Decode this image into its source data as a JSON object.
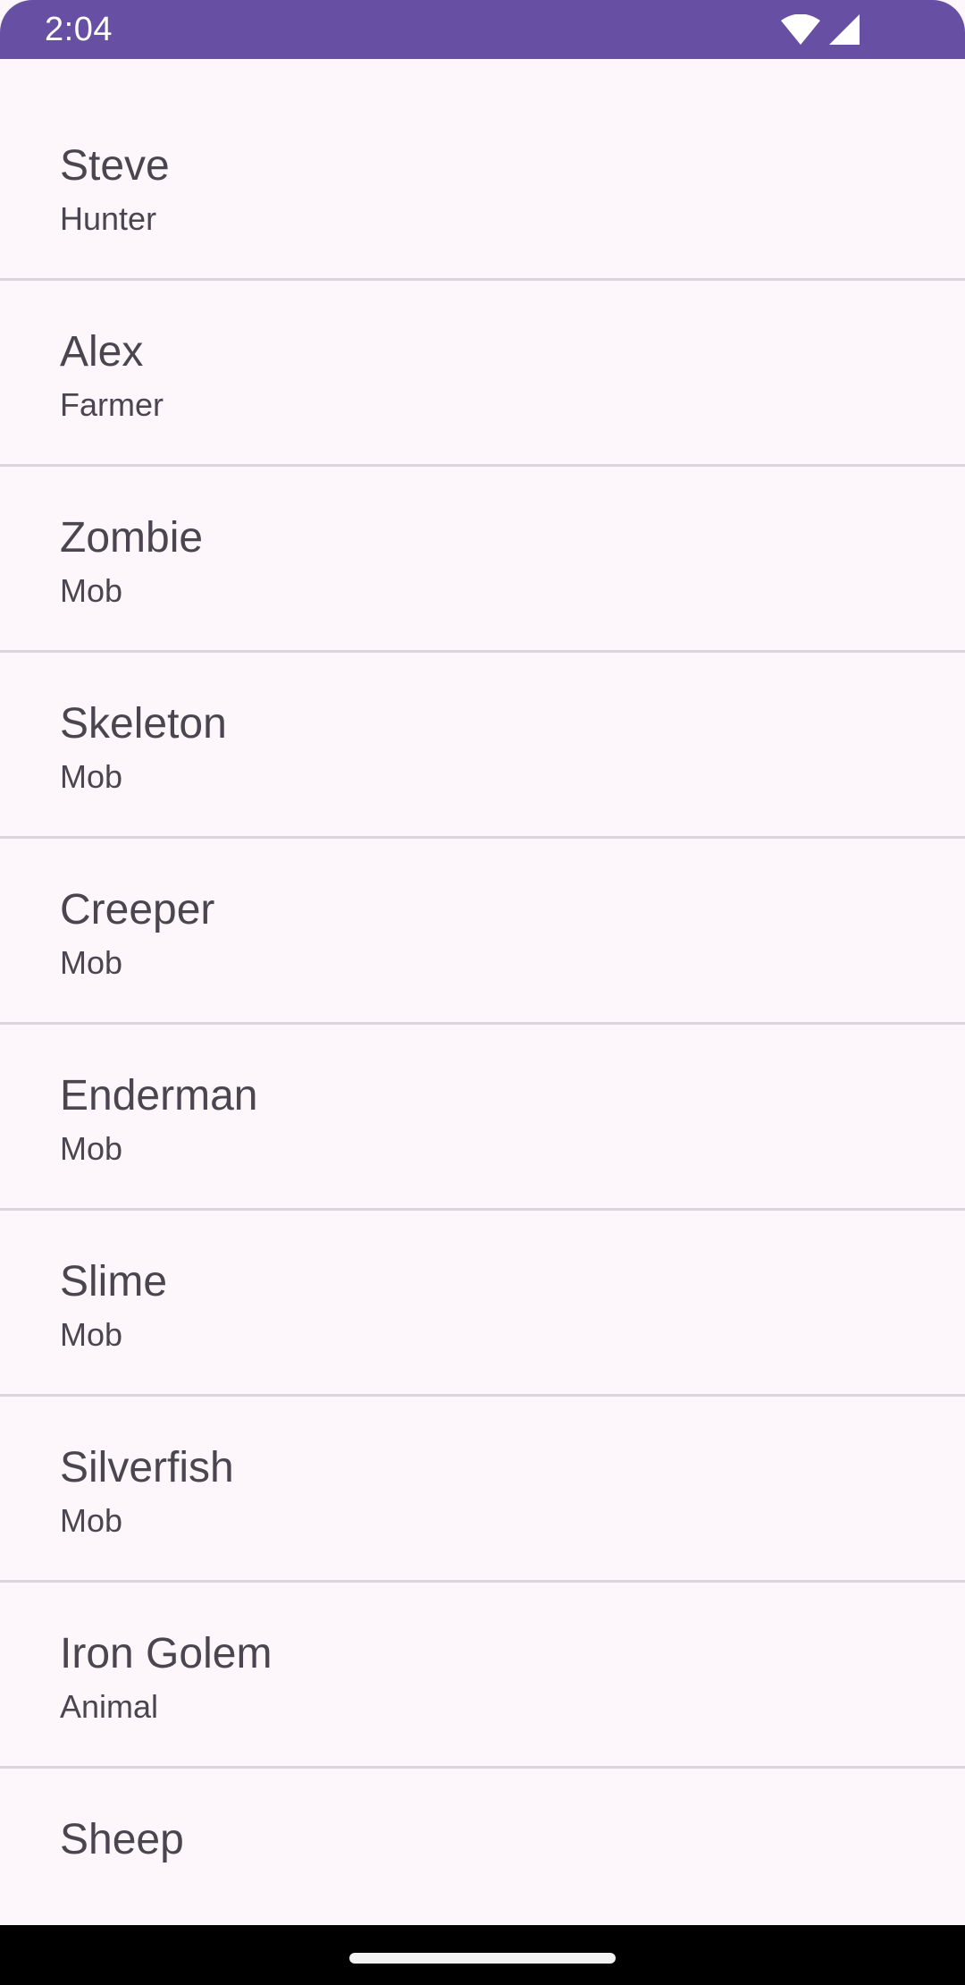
{
  "status_bar": {
    "time": "2:04",
    "icons": [
      "wifi-icon",
      "cell-signal-icon"
    ],
    "background": "#6750a4"
  },
  "list": {
    "items": [
      {
        "name": "Steve",
        "type": "Hunter"
      },
      {
        "name": "Alex",
        "type": "Farmer"
      },
      {
        "name": "Zombie",
        "type": "Mob"
      },
      {
        "name": "Skeleton",
        "type": "Mob"
      },
      {
        "name": "Creeper",
        "type": "Mob"
      },
      {
        "name": "Enderman",
        "type": "Mob"
      },
      {
        "name": "Slime",
        "type": "Mob"
      },
      {
        "name": "Silverfish",
        "type": "Mob"
      },
      {
        "name": "Iron Golem",
        "type": "Animal"
      },
      {
        "name": "Sheep"
      }
    ]
  },
  "colors": {
    "background": "#fdf7fc",
    "text": "#4a454e",
    "divider": "#d9d5da"
  }
}
